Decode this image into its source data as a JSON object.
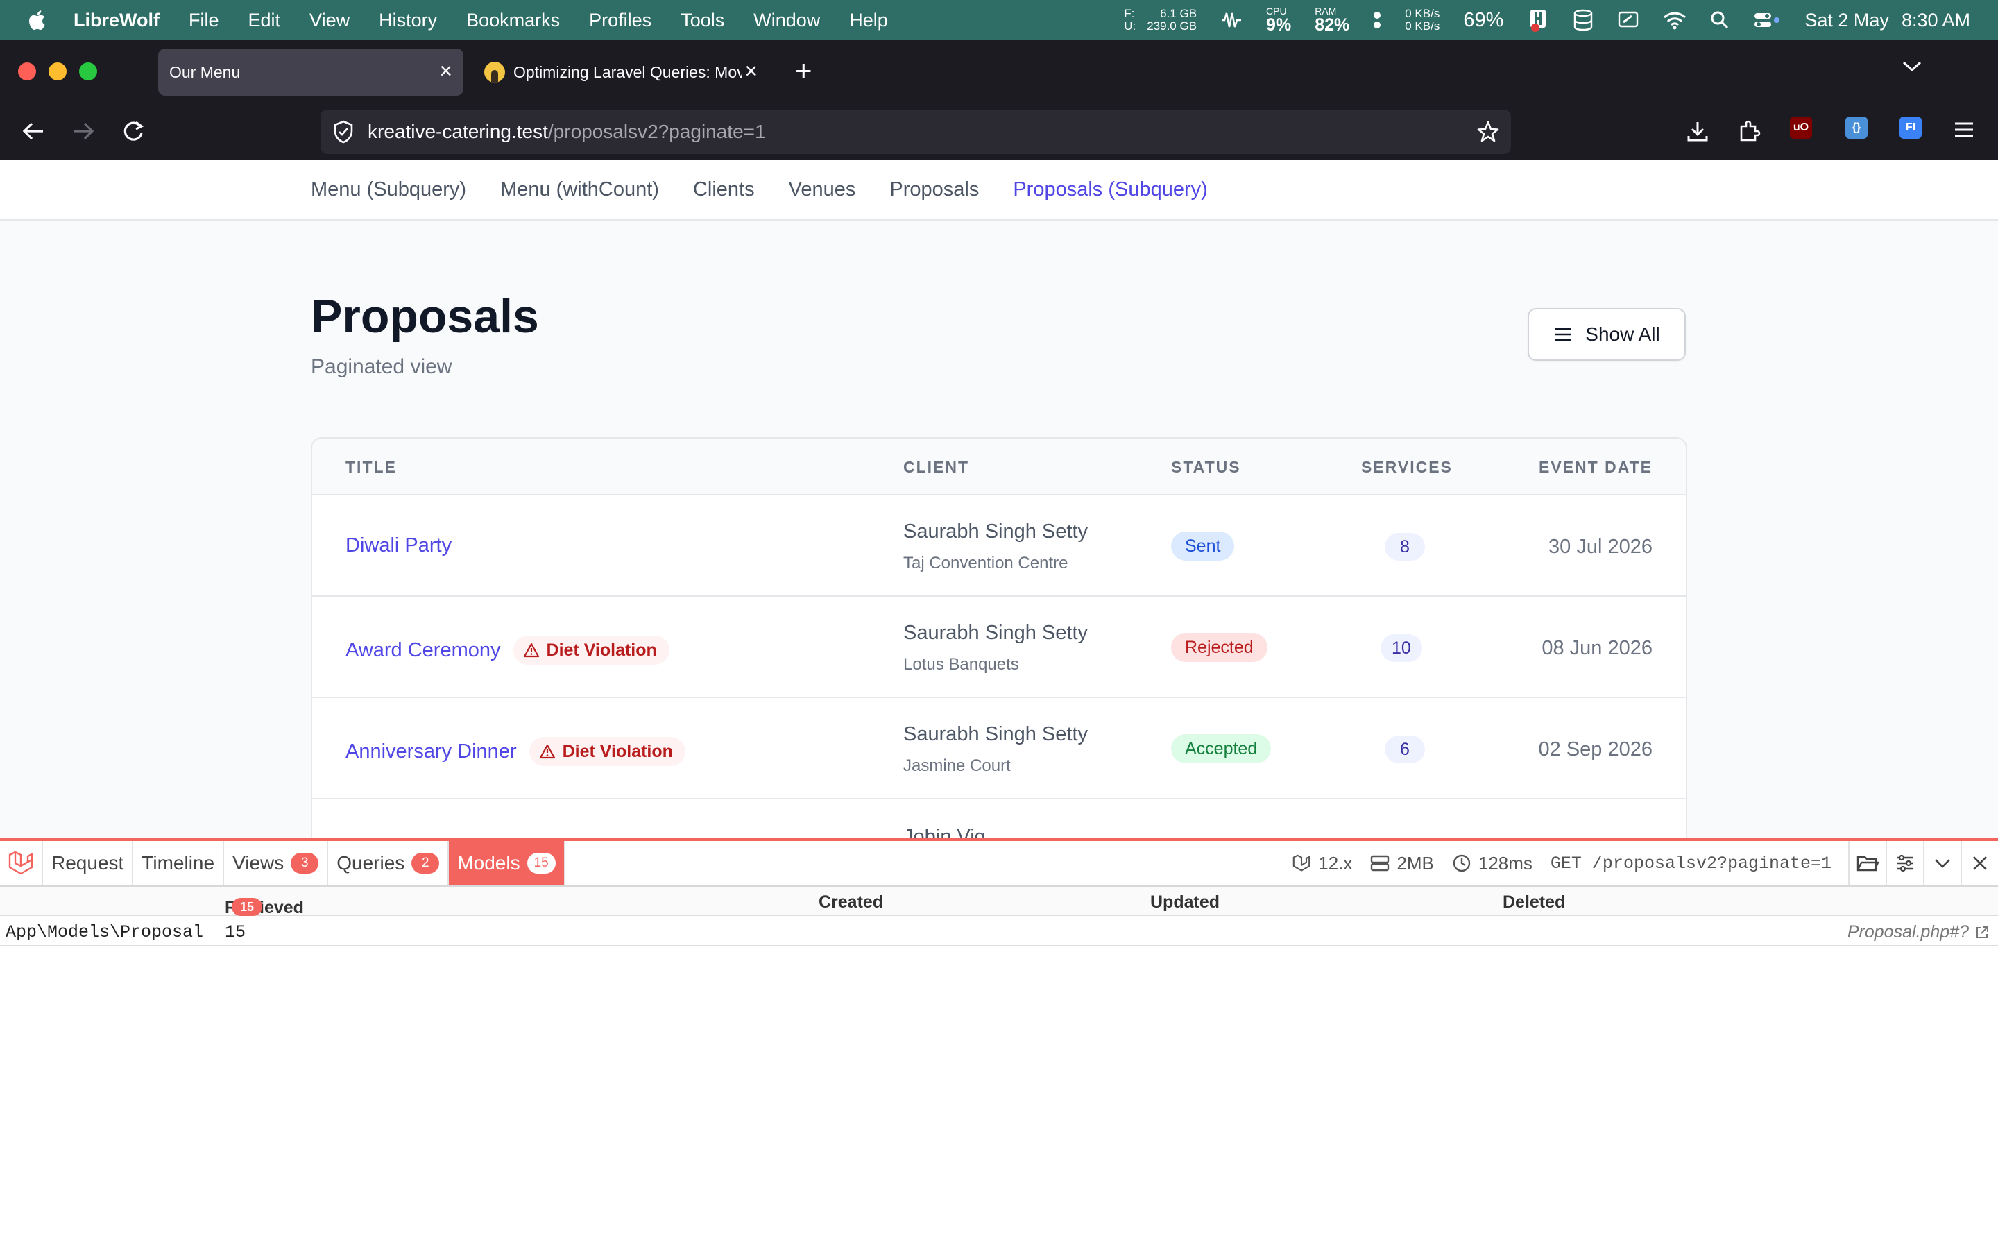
{
  "menubar": {
    "app_name": "LibreWolf",
    "items": [
      "File",
      "Edit",
      "View",
      "History",
      "Bookmarks",
      "Profiles",
      "Tools",
      "Window",
      "Help"
    ],
    "disk": {
      "f_label": "F:",
      "f_value": "6.1 GB",
      "u_label": "U:",
      "u_value": "239.0 GB"
    },
    "cpu": {
      "label": "CPU",
      "value": "9%"
    },
    "ram": {
      "label": "RAM",
      "value": "82%"
    },
    "net": {
      "up": "0 KB/s",
      "down": "0 KB/s"
    },
    "battery_pct": "69%",
    "date": "Sat 2 May",
    "time": "8:30 AM"
  },
  "browser": {
    "tabs": [
      {
        "title": "Our Menu",
        "active": true
      },
      {
        "title": "Optimizing Laravel Queries: Mov",
        "active": false
      }
    ],
    "url_host": "kreative-catering.test",
    "url_path": "/proposalsv2?paginate=1"
  },
  "page": {
    "nav": [
      "Menu (Subquery)",
      "Menu (withCount)",
      "Clients",
      "Venues",
      "Proposals",
      "Proposals (Subquery)"
    ],
    "active_nav": "Proposals (Subquery)",
    "title": "Proposals",
    "subtitle": "Paginated view",
    "show_all_label": "Show All",
    "table": {
      "headers": {
        "title": "TITLE",
        "client": "CLIENT",
        "status": "STATUS",
        "services": "SERVICES",
        "event_date": "EVENT DATE"
      },
      "rows": [
        {
          "title": "Diwali Party",
          "violation": "",
          "client": "Saurabh Singh Setty",
          "venue": "Taj Convention Centre",
          "status": "Sent",
          "services": "8",
          "date": "30 Jul 2026"
        },
        {
          "title": "Award Ceremony",
          "violation": "Diet Violation",
          "client": "Saurabh Singh Setty",
          "venue": "Lotus Banquets",
          "status": "Rejected",
          "services": "10",
          "date": "08 Jun 2026"
        },
        {
          "title": "Anniversary Dinner",
          "violation": "Diet Violation",
          "client": "Saurabh Singh Setty",
          "venue": "Jasmine Court",
          "status": "Accepted",
          "services": "6",
          "date": "02 Sep 2026"
        },
        {
          "title": "",
          "violation": "",
          "client": "Jobin Vig",
          "venue": "",
          "status": "",
          "services": "",
          "date": ""
        }
      ]
    },
    "status_colors": {
      "Sent": "#dbeafe",
      "Rejected": "#fee2e2",
      "Accepted": "#dcfce7"
    }
  },
  "debugbar": {
    "tabs": [
      {
        "label": "Request",
        "badge": ""
      },
      {
        "label": "Timeline",
        "badge": ""
      },
      {
        "label": "Views",
        "badge": "3"
      },
      {
        "label": "Queries",
        "badge": "2"
      },
      {
        "label": "Models",
        "badge": "15",
        "active": true
      }
    ],
    "laravel_version": "12.x",
    "memory": "2MB",
    "duration": "128ms",
    "request": "GET /proposalsv2?paginate=1",
    "models_table": {
      "headers": {
        "retrieved": "Retrieved",
        "retrieved_badge": "15",
        "created": "Created",
        "updated": "Updated",
        "deleted": "Deleted"
      },
      "rows": [
        {
          "model": "App\\Models\\Proposal",
          "retrieved": "15",
          "file": "Proposal.php#?"
        }
      ]
    },
    "accent_color": "#f4645f"
  }
}
